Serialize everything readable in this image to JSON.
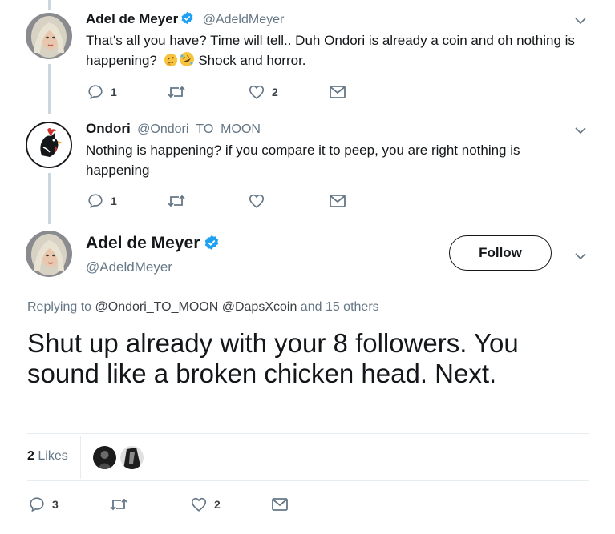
{
  "tweet1": {
    "name": "Adel de Meyer",
    "handle": "@AdeldMeyer",
    "text_line1": "That's all you have? Time will tell.. Duh Ondori is already a coin and oh nothing is",
    "text_line2a": "happening?",
    "text_line2b": "Shock and horror.",
    "emojis": [
      "thinking-face",
      "rolling-on-floor-laughing"
    ],
    "reply_count": "1",
    "like_count": "2"
  },
  "tweet2": {
    "name": "Ondori",
    "handle": "@Ondori_TO_MOON",
    "text_line1": "Nothing is happening?  if you compare it to peep, you are right nothing is",
    "text_line2": "happening",
    "reply_count": "1"
  },
  "main_tweet": {
    "name": "Adel de Meyer",
    "handle": "@AdeldMeyer",
    "follow_label": "Follow",
    "replying_prefix": "Replying to",
    "replying_user1": "@Ondori_TO_MOON",
    "replying_user2": "@DapsXcoin",
    "replying_suffix": "and 15 others",
    "text_line1": "Shut up already with your 8 followers. You",
    "text_line2": "sound like a broken chicken head. Next.",
    "likes_count": "2",
    "likes_label": "Likes",
    "reply_count": "3",
    "like_count": "2"
  },
  "colors": {
    "verified": "#1da1f2",
    "text_primary": "#14171a",
    "text_secondary": "#657786",
    "link": "#1da1f2"
  }
}
